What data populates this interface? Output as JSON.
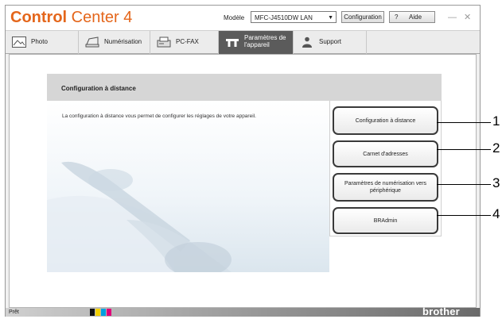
{
  "app": {
    "logo_bold": "Control",
    "logo_regular": " Center 4",
    "model_label": "Modèle",
    "model_value": "MFC-J4510DW LAN",
    "config_button": "Configuration",
    "help_button": "?",
    "help_label": "Aide",
    "minimize_glyph": "—",
    "close_glyph": "✕"
  },
  "tabs": [
    {
      "label": "Photo",
      "icon": "photo-icon",
      "active": false
    },
    {
      "label": "Numérisation",
      "icon": "scanner-icon",
      "active": false
    },
    {
      "label": "PC-FAX",
      "icon": "fax-icon",
      "active": false
    },
    {
      "label": "Paramètres de l'appareil",
      "icon": "device-settings-icon",
      "active": true
    },
    {
      "label": "Support",
      "icon": "support-icon",
      "active": false
    }
  ],
  "panel": {
    "title": "Configuration à distance",
    "description": "La configuration à distance vous permet de configurer les réglages de votre appareil."
  },
  "buttons": [
    {
      "label": "Configuration à distance"
    },
    {
      "label": "Carnet d'adresses"
    },
    {
      "label": "Paramètres de numérisation vers périphérique"
    },
    {
      "label": "BRAdmin"
    }
  ],
  "callouts": [
    "1",
    "2",
    "3",
    "4"
  ],
  "status": {
    "text": "Prêt",
    "brand": "brother",
    "ink_colors": [
      "#111111",
      "#f2d000",
      "#00a0e0",
      "#e0007a"
    ]
  },
  "colors": {
    "brand_orange": "#e4661b",
    "active_tab": "#5b5b5b",
    "header_grey": "#d6d6d6"
  }
}
